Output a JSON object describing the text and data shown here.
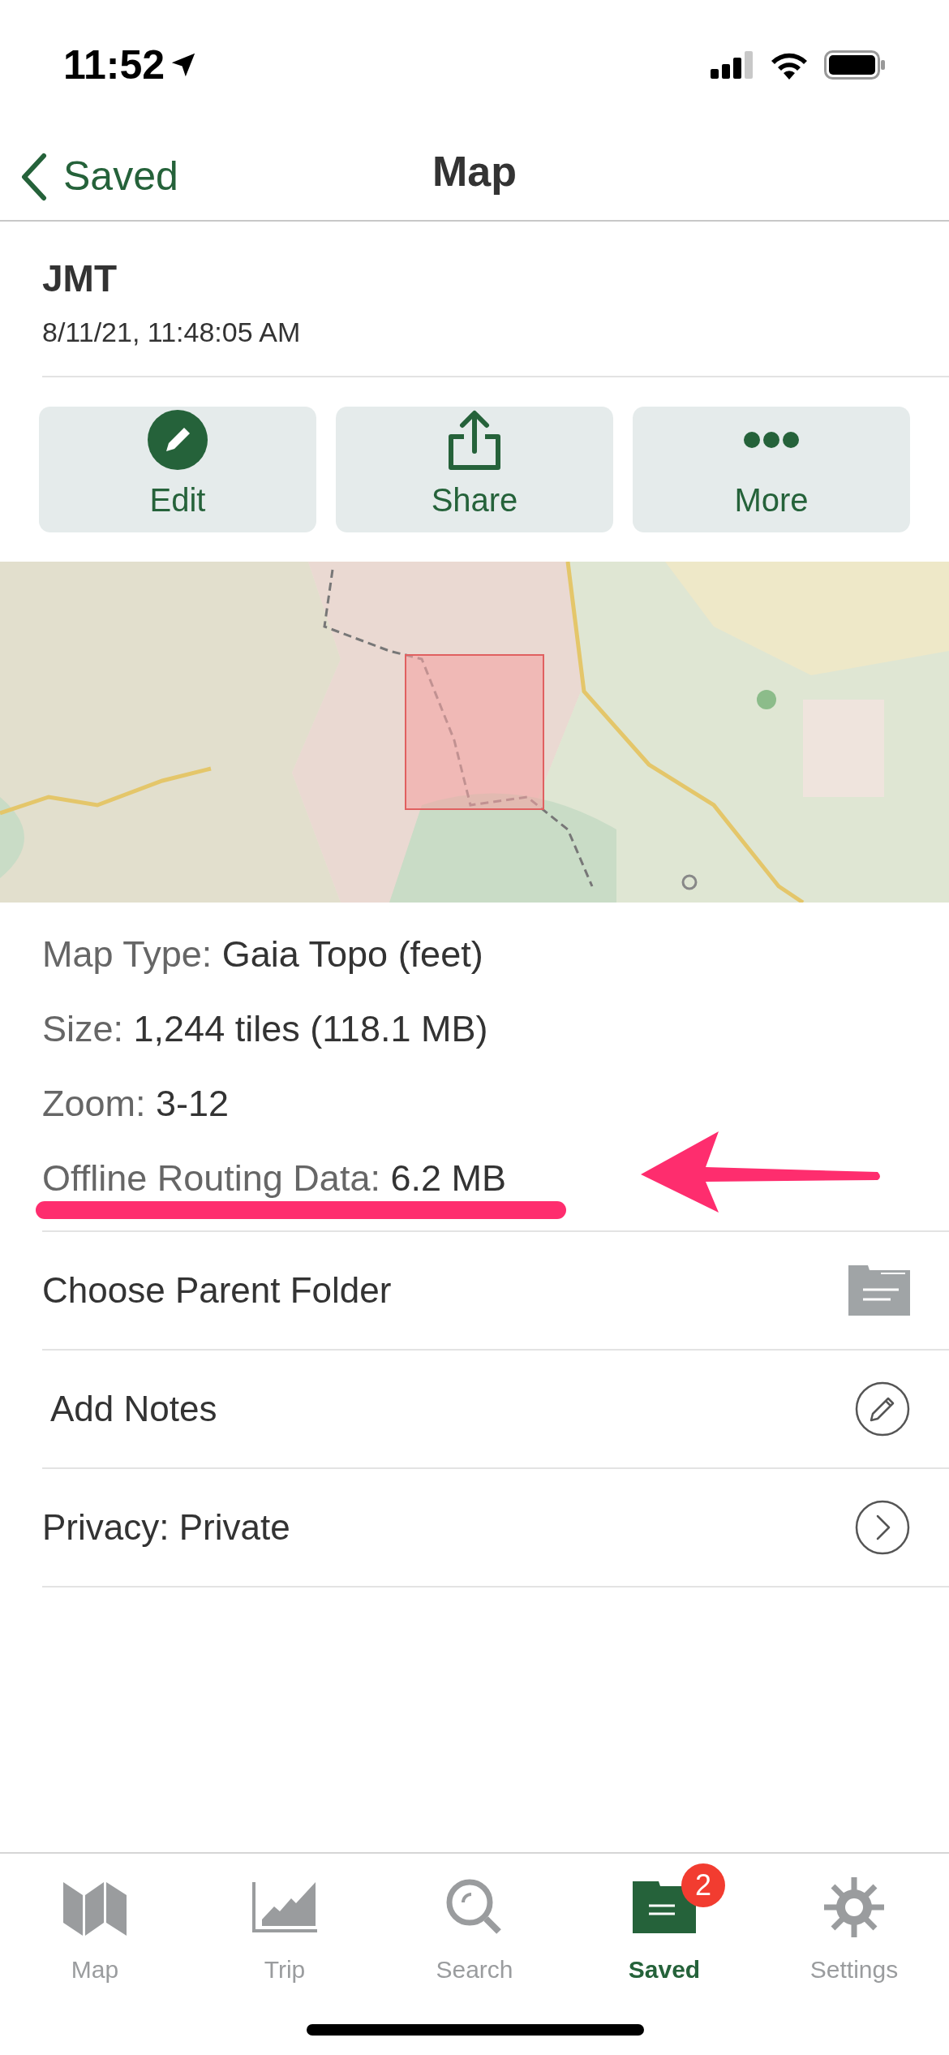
{
  "status_bar": {
    "time": "11:52"
  },
  "nav": {
    "back": "Saved",
    "title": "Map"
  },
  "map_item": {
    "name": "JMT",
    "date": "8/11/21, 11:48:05 AM"
  },
  "actions": [
    {
      "kind": "edit",
      "label": "Edit"
    },
    {
      "kind": "share",
      "label": "Share"
    },
    {
      "kind": "more",
      "label": "More"
    }
  ],
  "details": [
    {
      "label": "Map Type:",
      "value": "Gaia Topo (feet)",
      "highlighted": false
    },
    {
      "label": "Size:",
      "value": "1,244 tiles (118.1 MB)",
      "highlighted": false
    },
    {
      "label": "Zoom:",
      "value": "3-12",
      "highlighted": false
    },
    {
      "label": "Offline Routing Data:",
      "value": "6.2 MB",
      "highlighted": true
    }
  ],
  "options": [
    {
      "kind": "folder",
      "label": "Choose Parent Folder"
    },
    {
      "kind": "notes",
      "label": "Add Notes"
    },
    {
      "kind": "privacy",
      "label": "Privacy: Private"
    }
  ],
  "tab_bar": [
    {
      "kind": "map",
      "label": "Map",
      "selected": false
    },
    {
      "kind": "trip",
      "label": "Trip",
      "selected": false
    },
    {
      "kind": "search",
      "label": "Search",
      "selected": false
    },
    {
      "kind": "saved",
      "label": "Saved",
      "selected": true,
      "badge": "2"
    },
    {
      "kind": "settings",
      "label": "Settings",
      "selected": false
    }
  ]
}
